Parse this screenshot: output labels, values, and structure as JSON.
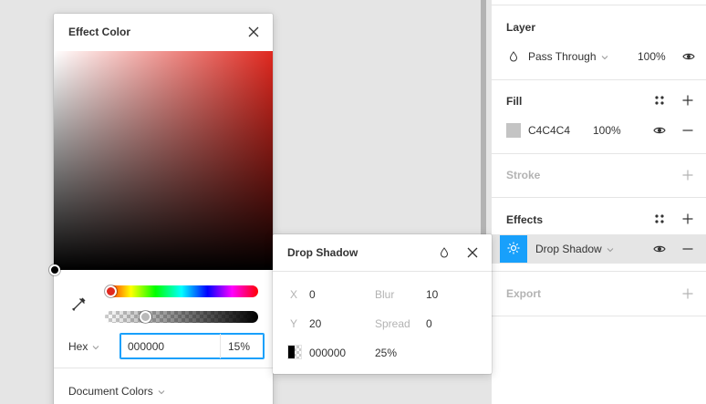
{
  "right_panel": {
    "layer": {
      "title": "Layer",
      "blend_mode": "Pass Through",
      "opacity": "100%",
      "icons": [
        "drop-icon",
        "chevron-down-icon",
        "eye-icon"
      ]
    },
    "fill": {
      "title": "Fill",
      "hex": "C4C4C4",
      "opacity": "100%",
      "swatch_color": "#c4c4c4"
    },
    "stroke": {
      "title": "Stroke"
    },
    "effects": {
      "title": "Effects",
      "item_label": "Drop Shadow",
      "item_icon_bg": "#18a0fb"
    },
    "export": {
      "title": "Export"
    }
  },
  "effect_color": {
    "title": "Effect Color",
    "hue_color": "#e0281f",
    "mode_label": "Hex",
    "hex_value": "000000",
    "alpha_value": "15%",
    "document_colors_label": "Document Colors"
  },
  "drop_shadow": {
    "title": "Drop Shadow",
    "x_label": "X",
    "x_value": "0",
    "y_label": "Y",
    "y_value": "20",
    "blur_label": "Blur",
    "blur_value": "10",
    "spread_label": "Spread",
    "spread_value": "0",
    "color_hex": "000000",
    "color_opacity": "25%"
  },
  "colors": {
    "accent": "#18a0fb",
    "canvas": "#e5e5e5",
    "divider": "#b3b3b3"
  }
}
